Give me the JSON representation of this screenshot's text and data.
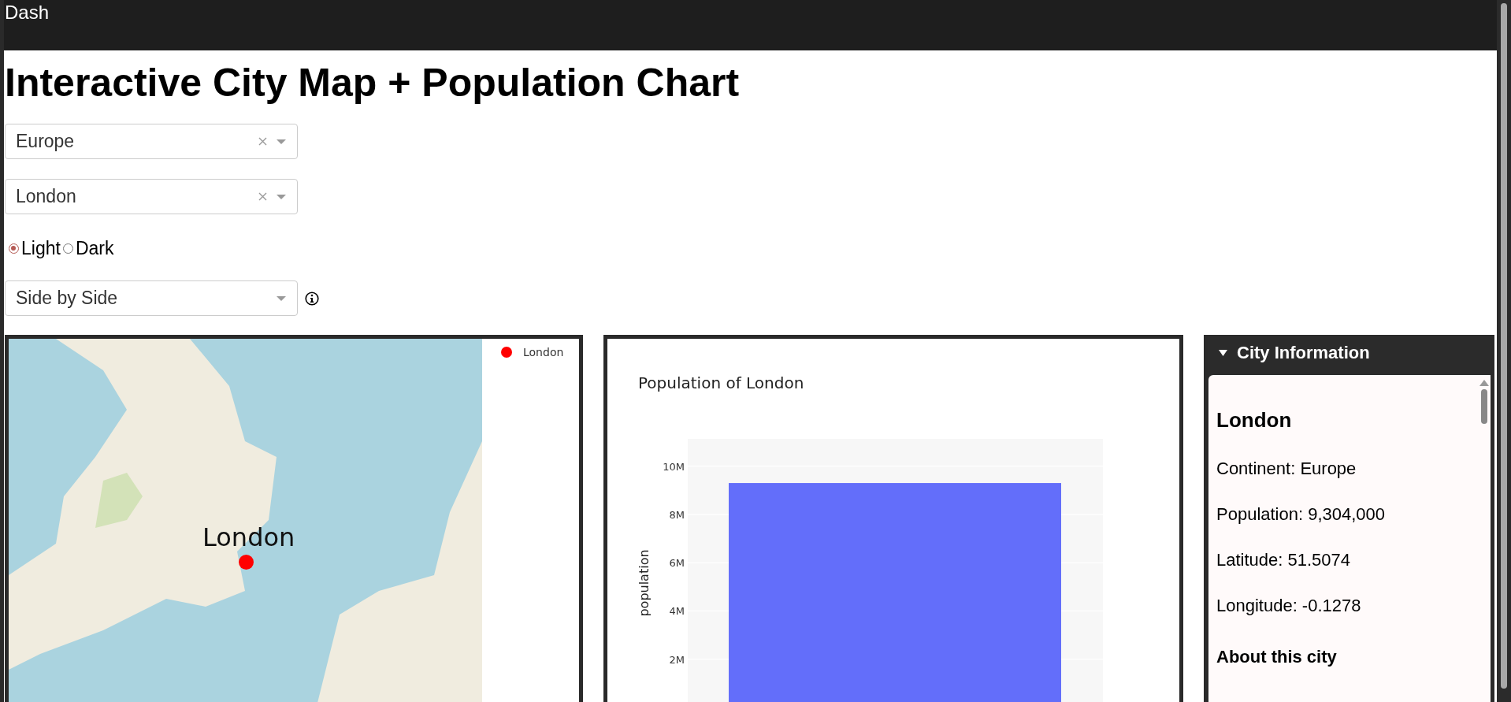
{
  "app_bar": {
    "title": "Dash"
  },
  "heading": "Interactive City Map + Population Chart",
  "continent_dropdown": {
    "value": "Europe",
    "clearable": true
  },
  "city_dropdown": {
    "value": "London",
    "clearable": true
  },
  "theme_radios": [
    {
      "label": "Light",
      "selected": true
    },
    {
      "label": "Dark",
      "selected": false
    }
  ],
  "layout_dropdown": {
    "value": "Side by Side",
    "clearable": false
  },
  "map_panel": {
    "marker_label": "London",
    "legend": [
      {
        "label": "London"
      }
    ]
  },
  "chart_panel": {
    "chart_data": {
      "type": "bar",
      "title": "Population of London",
      "ylabel": "population",
      "values": [
        9300000
      ],
      "grid": true,
      "ylim": [
        0,
        11130000
      ],
      "yticks": [
        {
          "value": 2000000,
          "label": "2M"
        },
        {
          "value": 4000000,
          "label": "4M"
        },
        {
          "value": 6000000,
          "label": "6M"
        },
        {
          "value": 8000000,
          "label": "8M"
        },
        {
          "value": 10000000,
          "label": "10M"
        }
      ]
    }
  },
  "info_panel": {
    "title": "City Information",
    "expanded": true,
    "city": "London",
    "lines": [
      "Continent: Europe",
      "Population: 9,304,000",
      "Latitude: 51.5074",
      "Longitude: -0.1278"
    ],
    "section_heading": "About this city"
  }
}
